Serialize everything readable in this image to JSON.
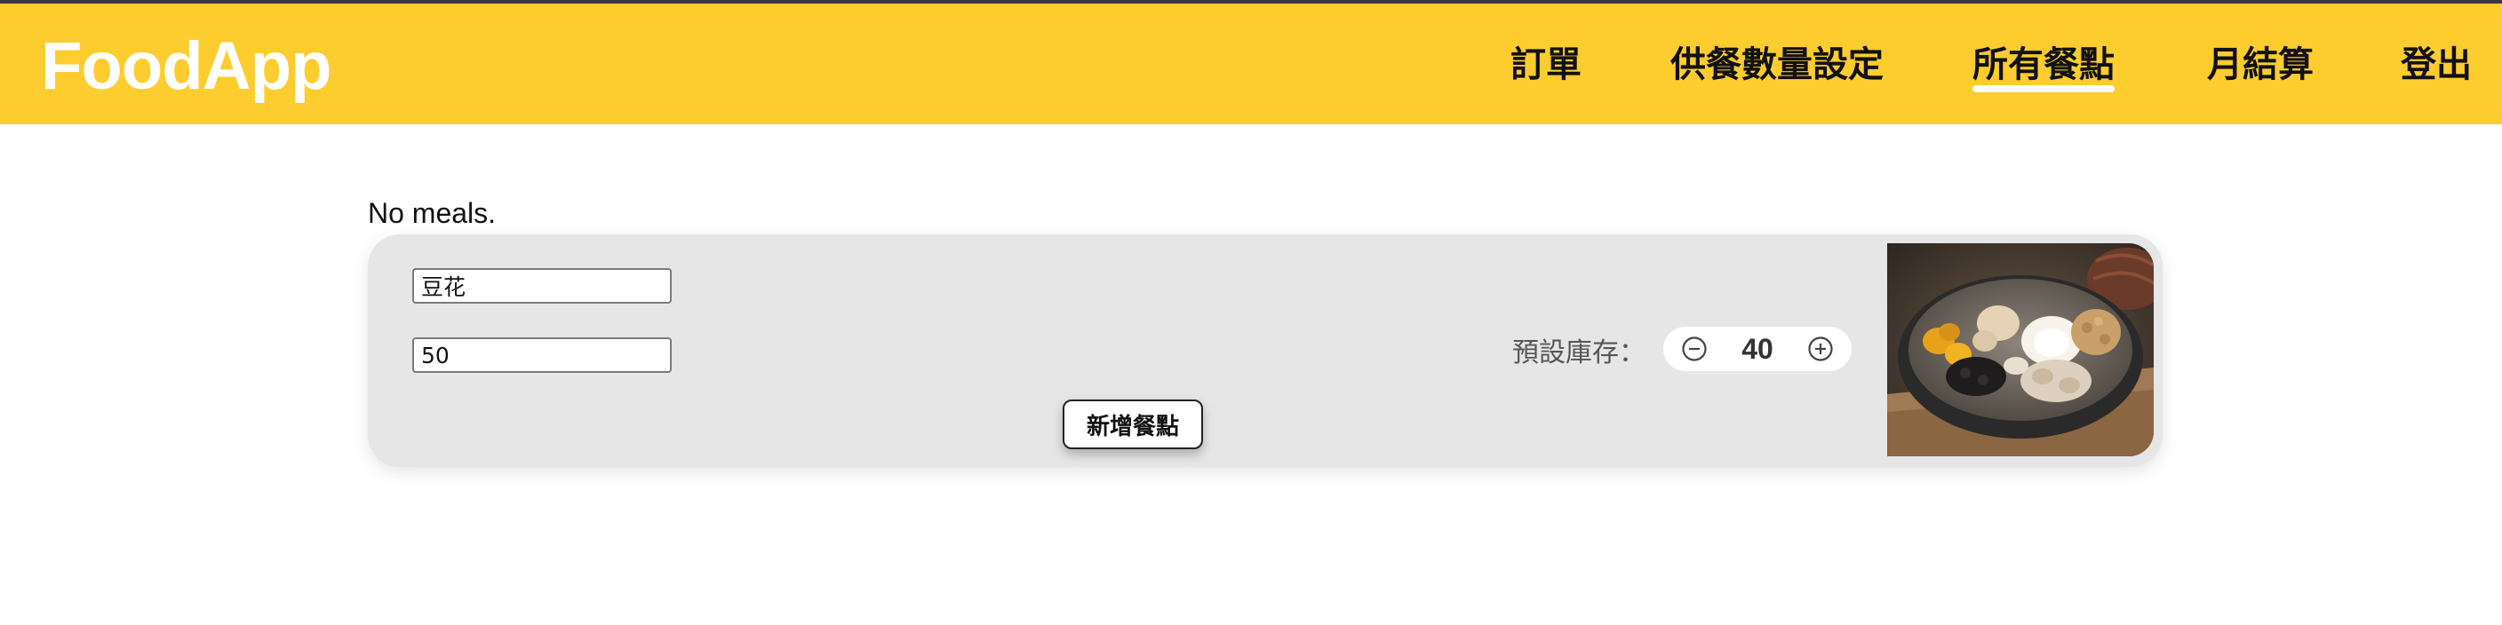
{
  "app": {
    "title": "FoodApp"
  },
  "nav": {
    "items": [
      {
        "label": "訂單"
      },
      {
        "label": "供餐數量設定"
      },
      {
        "label": "所有餐點",
        "active": true
      },
      {
        "label": "月結算"
      },
      {
        "label": "登出"
      }
    ]
  },
  "colors": {
    "header": "#fdcc2e",
    "card": "#e6e6e6",
    "logo": "#ffffff"
  },
  "main": {
    "empty_message": "No meals.",
    "form": {
      "name_value": "豆花",
      "price_value": "50",
      "submit_label": "新增餐點",
      "stock_label": "預設庫存：",
      "stock_value": "40"
    },
    "image": {
      "icon": "dessert-bowl-photo"
    }
  }
}
